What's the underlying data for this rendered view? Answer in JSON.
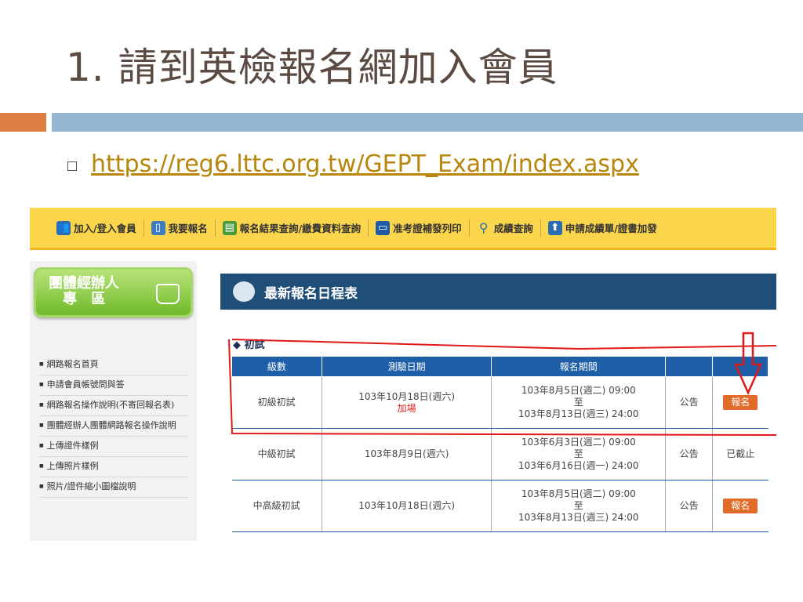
{
  "slide": {
    "title": "1. 請到英檢報名網加入會員",
    "url": "https://reg6.lttc.org.tw/GEPT_Exam/index.aspx"
  },
  "nav": {
    "items": [
      {
        "label": "加入/登入會員",
        "icon": "members-icon"
      },
      {
        "label": "我要報名",
        "icon": "book-icon"
      },
      {
        "label": "報名結果查詢/繳費資料查詢",
        "icon": "printer-icon"
      },
      {
        "label": "准考證補發列印",
        "icon": "monitor-icon"
      },
      {
        "label": "成績查詢",
        "icon": "search-icon"
      },
      {
        "label": "申請成績單/證書加發",
        "icon": "upload-icon"
      }
    ]
  },
  "sidebar": {
    "group_button": {
      "line1": "團體經辦人",
      "line2": "專 區"
    },
    "links": [
      "網路報名首頁",
      "申請會員帳號問與答",
      "網路報名操作說明(不寄回報名表)",
      "團體經辦人團體網路報名操作說明",
      "上傳證件樣例",
      "上傳照片樣例",
      "照片/證件縮小圖檔說明"
    ]
  },
  "main": {
    "heading": "最新報名日程表",
    "section": "◆ 初試",
    "columns": [
      "級數",
      "測驗日期",
      "報名期間",
      "",
      ""
    ],
    "rows": [
      {
        "level": "初級初試",
        "date": "103年10月18日(週六)",
        "extra": "加場",
        "period_start": "103年8月5日(週二) 09:00",
        "to": "至",
        "period_end": "103年8月13日(週三) 24:00",
        "notice": "公告",
        "action": "報名",
        "open": true
      },
      {
        "level": "中級初試",
        "date": "103年8月9日(週六)",
        "extra": "",
        "period_start": "103年6月3日(週二) 09:00",
        "to": "至",
        "period_end": "103年6月16日(週一) 24:00",
        "notice": "公告",
        "action": "已截止",
        "open": false
      },
      {
        "level": "中高級初試",
        "date": "103年10月18日(週六)",
        "extra": "",
        "period_start": "103年8月5日(週二) 09:00",
        "to": "至",
        "period_end": "103年8月13日(週三) 24:00",
        "notice": "公告",
        "action": "報名",
        "open": true
      }
    ]
  },
  "colors": {
    "accent_orange": "#dd8047",
    "accent_blue": "#94b6d2",
    "nav_yellow": "#fbd54c",
    "header_blue": "#1f4e79",
    "table_blue": "#1f5fa8",
    "annotation_red": "#e01818"
  }
}
